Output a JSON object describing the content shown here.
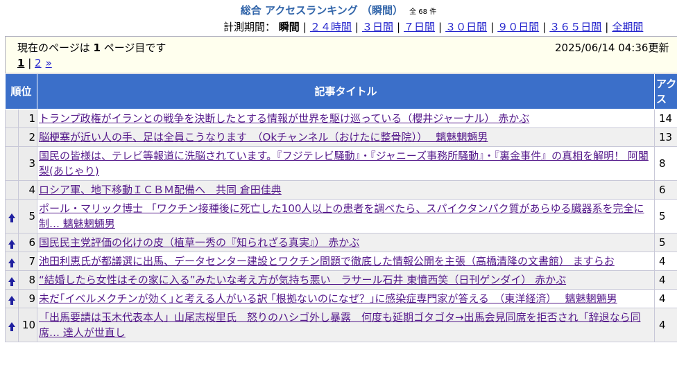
{
  "header": {
    "title": "総合 アクセスランキング （瞬間）",
    "count": "全 68 件"
  },
  "period": {
    "label": "計測期間：",
    "current": "瞬間",
    "links": [
      "２４時間",
      "３日間",
      "７日間",
      "３０日間",
      "９０日間",
      "３６５日間",
      "全期間"
    ]
  },
  "info": {
    "page_text_before": "現在のページは ",
    "page_number": "1",
    "page_text_after": " ページ目です",
    "updated": "2025/06/14 04:36更新"
  },
  "pager": {
    "current": "1",
    "next_page": "2",
    "next_arrow": "»"
  },
  "table": {
    "col_rank": "順位",
    "col_title": "記事タイトル",
    "col_access": "アクセス",
    "rows": [
      {
        "rank": "1",
        "up": false,
        "title": "トランプ政権がイランとの戦争を決断したとする情報が世界を駆け巡っている（櫻井ジャーナル） 赤かぶ",
        "access": "14"
      },
      {
        "rank": "2",
        "up": false,
        "title": "脳梗塞が近い人の手、足は全員こうなります　（Okチャンネル（おけたに整骨院））　 魑魅魍魎男",
        "access": "13"
      },
      {
        "rank": "3",
        "up": false,
        "title": "国民の皆様は、テレビ等報道に洗脳されています。『フジテレビ騒動』・『ジャニーズ事務所騒動』・『裏金事件』の真相を解明！ 阿闍梨(あじゃり)",
        "access": "8"
      },
      {
        "rank": "4",
        "up": false,
        "title": "ロシア軍、地下移動ＩＣＢＭ配備へ　共同 倉田佳典",
        "access": "6"
      },
      {
        "rank": "5",
        "up": true,
        "title": "ポール・マリック博士 「ワクチン接種後に死亡した100人以上の患者を調べたら、スパイクタンパク質があらゆる臓器系を完全に制… 魑魅魍魎男",
        "access": "5"
      },
      {
        "rank": "6",
        "up": true,
        "title": "国民民主党評価の化けの皮（植草一秀の『知られざる真実』） 赤かぶ",
        "access": "5"
      },
      {
        "rank": "7",
        "up": true,
        "title": "池田利恵氏が都議選に出馬、データセンター建設とワクチン問題で徹底した情報公開を主張（高橋清隆の文書館） ますらお",
        "access": "4"
      },
      {
        "rank": "8",
        "up": true,
        "title": "“結婚したら女性はその家に入る”みたいな考え方が気持ち悪い　ラサール石井 東憤西笑（日刊ゲンダイ） 赤かぶ",
        "access": "4"
      },
      {
        "rank": "9",
        "up": true,
        "title": "未だ｢イベルメクチンが効く｣と考える人がいる訳 ｢根拠ないのになぜ？｣に感染症専門家が答える　（東洋経済）　 魑魅魍魎男",
        "access": "4"
      },
      {
        "rank": "10",
        "up": true,
        "title": "「出馬要請は玉木代表本人」山尾志桜里氏　怒りのハシゴ外し暴露　何度も延期ゴタゴタ→出馬会見同席を拒否され「辞退なら同席… 達人が世直し",
        "access": "4"
      }
    ]
  }
}
